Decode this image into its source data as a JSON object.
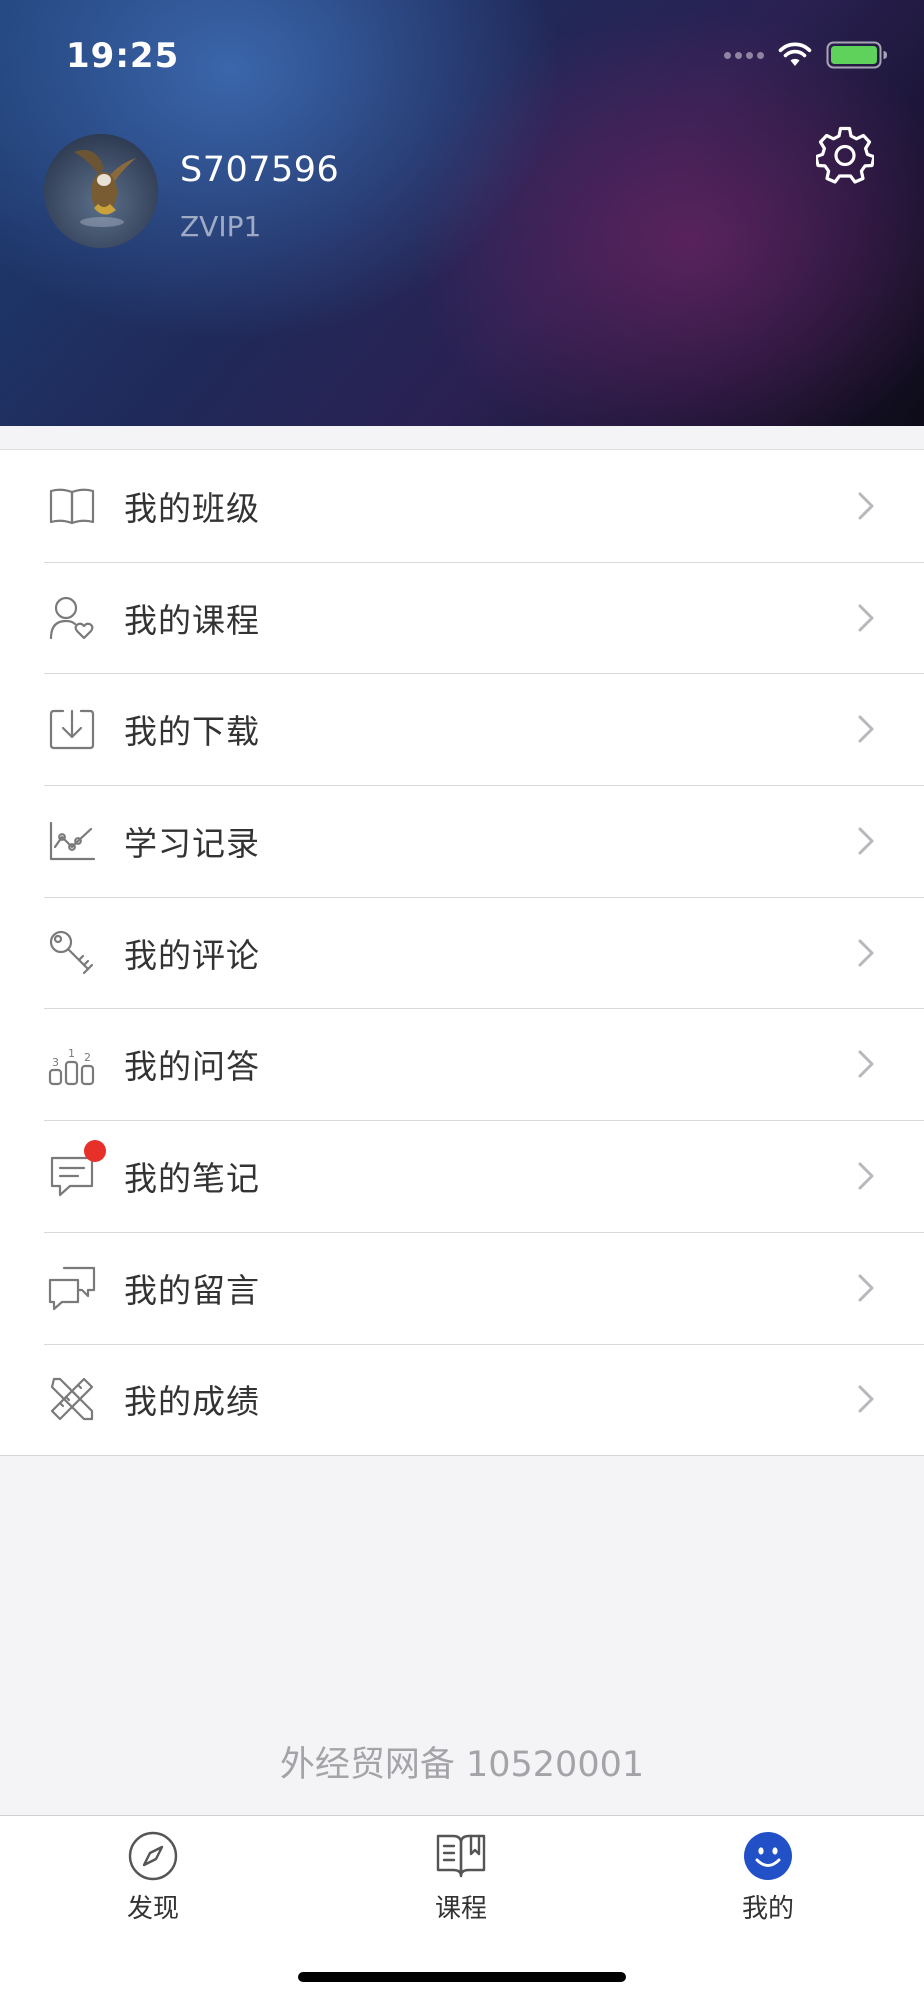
{
  "status_bar": {
    "time": "19:25"
  },
  "profile": {
    "username": "S707596",
    "level": "ZVIP1"
  },
  "menu": {
    "items": [
      {
        "label": "我的班级",
        "icon": "open-book-icon"
      },
      {
        "label": "我的课程",
        "icon": "user-heart-icon"
      },
      {
        "label": "我的下载",
        "icon": "download-icon"
      },
      {
        "label": "学习记录",
        "icon": "line-chart-icon"
      },
      {
        "label": "我的评论",
        "icon": "key-icon"
      },
      {
        "label": "我的问答",
        "icon": "podium-ranking-icon"
      },
      {
        "label": "我的笔记",
        "icon": "chat-message-icon",
        "badge": true
      },
      {
        "label": "我的留言",
        "icon": "chat-bubbles-icon"
      },
      {
        "label": "我的成绩",
        "icon": "ruler-pencil-icon"
      }
    ]
  },
  "footer": {
    "icp": "外经贸网备 10520001"
  },
  "tabbar": {
    "tabs": [
      {
        "label": "发现",
        "icon": "compass-icon",
        "active": false
      },
      {
        "label": "课程",
        "icon": "book-icon",
        "active": false
      },
      {
        "label": "我的",
        "icon": "smiley-icon",
        "active": true
      }
    ]
  },
  "colors": {
    "accent": "#2251c7",
    "badge": "#e8302a",
    "battery": "#5ed25a"
  }
}
